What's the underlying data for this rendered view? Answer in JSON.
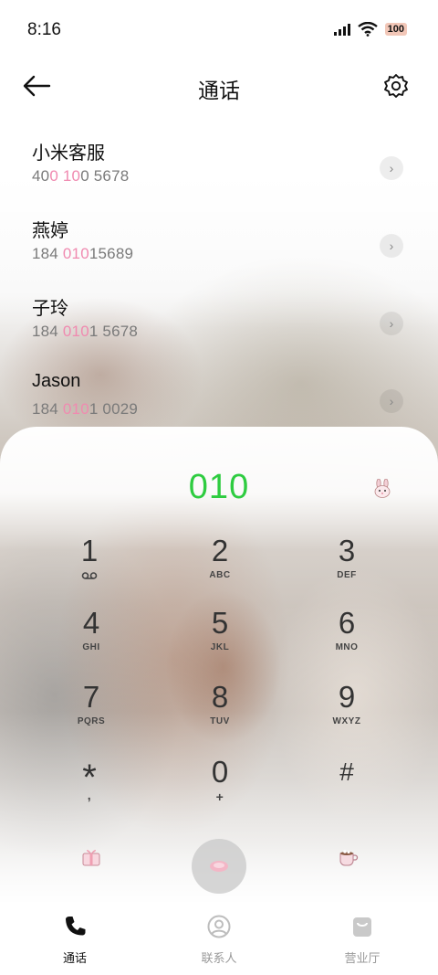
{
  "status_bar": {
    "time": "8:16",
    "battery": "100"
  },
  "header": {
    "title": "通话"
  },
  "contacts": [
    {
      "name": "小米客服",
      "number_parts": [
        "40",
        "0 10",
        "0 5678"
      ]
    },
    {
      "name": "燕婷",
      "number_parts": [
        "184 ",
        "010",
        "15689"
      ]
    },
    {
      "name": "子玲",
      "number_parts": [
        "184 ",
        "010",
        "1 5678"
      ]
    },
    {
      "name": "Jason",
      "number_parts": [
        "184 ",
        "010",
        "1 0029"
      ]
    }
  ],
  "dialer": {
    "input": "010",
    "keys": [
      {
        "digit": "1",
        "letters": ""
      },
      {
        "digit": "2",
        "letters": "ABC"
      },
      {
        "digit": "3",
        "letters": "DEF"
      },
      {
        "digit": "4",
        "letters": "GHI"
      },
      {
        "digit": "5",
        "letters": "JKL"
      },
      {
        "digit": "6",
        "letters": "MNO"
      },
      {
        "digit": "7",
        "letters": "PQRS"
      },
      {
        "digit": "8",
        "letters": "TUV"
      },
      {
        "digit": "9",
        "letters": "WXYZ"
      },
      {
        "digit": "*",
        "letters": ","
      },
      {
        "digit": "0",
        "letters": "+"
      },
      {
        "digit": "#",
        "letters": ""
      }
    ]
  },
  "nav": [
    {
      "label": "通话",
      "icon": "phone-icon",
      "active": true
    },
    {
      "label": "联系人",
      "icon": "contacts-icon",
      "active": false
    },
    {
      "label": "营业厅",
      "icon": "store-bag-icon",
      "active": false
    }
  ],
  "colors": {
    "accent_green": "#2ecc40",
    "highlight_pink": "#f08ab0"
  }
}
